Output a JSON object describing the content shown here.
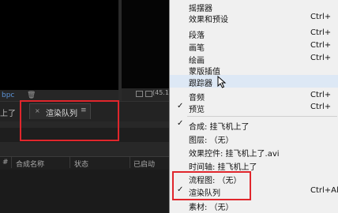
{
  "left_panel": {
    "bpc_label": "bpc",
    "zoom_label": "(45.1",
    "tabs": {
      "prev_label": "上了",
      "active_label": "渲染队列",
      "close_glyph": "×",
      "menu_glyph": "≡"
    },
    "columns": {
      "hash": "#",
      "comp_name": "合成名称",
      "status": "状态",
      "started": "已启动"
    }
  },
  "menu": {
    "items": [
      {
        "label": "摇摆器",
        "shortcut": "",
        "checked": false
      },
      {
        "label": "效果和预设",
        "shortcut": "Ctrl+",
        "checked": false
      },
      {
        "label": "段落",
        "shortcut": "Ctrl+",
        "checked": false
      },
      {
        "label": "画笔",
        "shortcut": "Ctrl+",
        "checked": false
      },
      {
        "label": "绘画",
        "shortcut": "Ctrl+",
        "checked": false
      },
      {
        "label": "蒙版插值",
        "shortcut": "",
        "checked": false
      },
      {
        "label": "跟踪器",
        "shortcut": "",
        "checked": false
      },
      {
        "label": "音频",
        "shortcut": "Ctrl+",
        "checked": false
      },
      {
        "label": "预览",
        "shortcut": "Ctrl+",
        "checked": true
      },
      {
        "label": "合成: 挂飞机上了",
        "shortcut": "",
        "checked": true
      },
      {
        "label": "图层: （无）",
        "shortcut": "",
        "checked": false
      },
      {
        "label": "效果控件: 挂飞机上了.avi",
        "shortcut": "",
        "checked": false
      },
      {
        "label": "时间轴: 挂飞机上了",
        "shortcut": "",
        "checked": false
      },
      {
        "label": "流程图: （无）",
        "shortcut": "",
        "checked": false
      },
      {
        "label": "渲染队列",
        "shortcut": "Ctrl+Alt+",
        "checked": true
      },
      {
        "label": "素材: （无）",
        "shortcut": "",
        "checked": false
      }
    ],
    "checkmark_glyph": "✓"
  },
  "colors": {
    "annotation_red": "#e0262c",
    "menu_bg": "#f0f0f0",
    "accent_blue": "#5b92d6"
  }
}
